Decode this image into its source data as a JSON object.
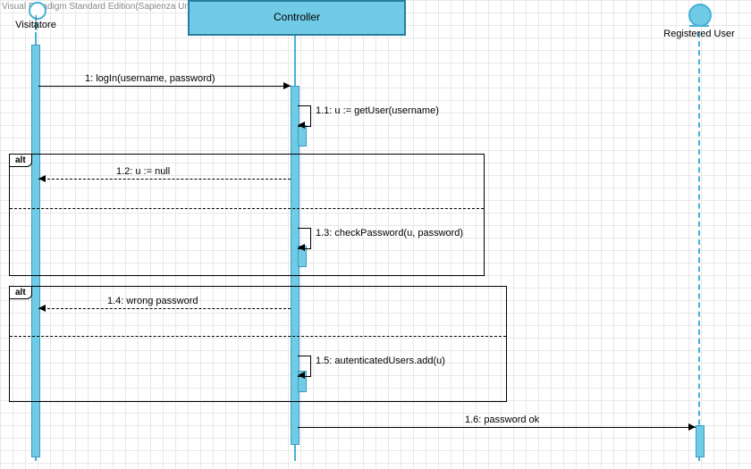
{
  "watermark": "Visual Paradigm Standard Edition(Sapienza University of Rome)",
  "participants": {
    "visitor": {
      "label": "Visitatore"
    },
    "controller": {
      "label": "Controller"
    },
    "registered": {
      "label": "Registered User"
    }
  },
  "messages": {
    "m1": "1: logIn(username, password)",
    "m11": "1.1: u := getUser(username)",
    "m12": "1.2: u := null",
    "m13": "1.3: checkPassword(u, password)",
    "m14": "1.4: wrong password",
    "m15": "1.5: autenticatedUsers.add(u)",
    "m16": "1.6: password ok"
  },
  "fragments": {
    "alt": "alt"
  },
  "chart_data": {
    "type": "uml-sequence-diagram",
    "tool": "Visual Paradigm Standard Edition",
    "owner": "Sapienza University of Rome",
    "participants": [
      {
        "id": "visitor",
        "name": "Visitatore",
        "kind": "actor"
      },
      {
        "id": "controller",
        "name": "Controller",
        "kind": "control"
      },
      {
        "id": "registered",
        "name": "Registered User",
        "kind": "actor"
      }
    ],
    "interactions": [
      {
        "seq": "1",
        "from": "visitor",
        "to": "controller",
        "label": "logIn(username, password)",
        "type": "call"
      },
      {
        "seq": "1.1",
        "from": "controller",
        "to": "controller",
        "label": "u := getUser(username)",
        "type": "self"
      },
      {
        "fragment": "alt",
        "blocks": [
          {
            "guard": null,
            "interactions": [
              {
                "seq": "1.2",
                "from": "controller",
                "to": "visitor",
                "label": "u := null",
                "type": "return"
              }
            ]
          },
          {
            "guard": null,
            "interactions": [
              {
                "seq": "1.3",
                "from": "controller",
                "to": "controller",
                "label": "checkPassword(u, password)",
                "type": "self"
              }
            ]
          }
        ]
      },
      {
        "fragment": "alt",
        "blocks": [
          {
            "guard": null,
            "interactions": [
              {
                "seq": "1.4",
                "from": "controller",
                "to": "visitor",
                "label": "wrong password",
                "type": "return"
              }
            ]
          },
          {
            "guard": null,
            "interactions": [
              {
                "seq": "1.5",
                "from": "controller",
                "to": "controller",
                "label": "autenticatedUsers.add(u)",
                "type": "self"
              }
            ]
          }
        ]
      },
      {
        "seq": "1.6",
        "from": "controller",
        "to": "registered",
        "label": "password ok",
        "type": "call"
      }
    ]
  }
}
